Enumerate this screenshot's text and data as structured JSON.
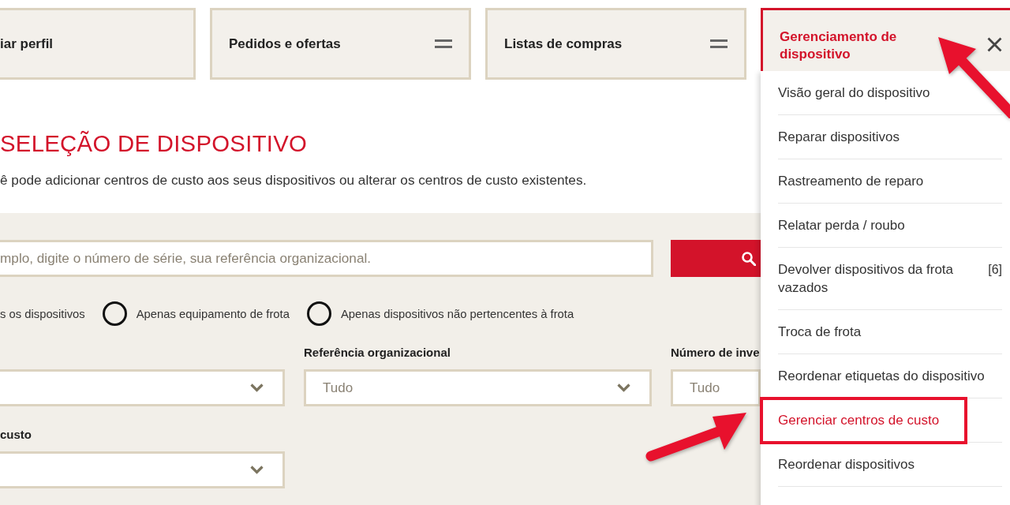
{
  "nav": {
    "tabs": [
      {
        "label": "iar perfil",
        "kind": "plain"
      },
      {
        "label": "Pedidos e ofertas",
        "kind": "menu"
      },
      {
        "label": "Listas de compras",
        "kind": "menu"
      }
    ]
  },
  "page": {
    "title": "SELEÇÃO DE DISPOSITIVO",
    "description": "ê pode adicionar centros de custo aos seus dispositivos ou alterar os centros de custo existentes."
  },
  "search": {
    "placeholder": "mplo, digite o número de série, sua referência organizacional."
  },
  "device_filter": [
    {
      "label": "s os dispositivos"
    },
    {
      "label": "Apenas equipamento de frota",
      "selected": false
    },
    {
      "label": "Apenas dispositivos não pertencentes à frota",
      "selected": false
    }
  ],
  "filters": [
    {
      "kind": "select"
    },
    {
      "kind": "select",
      "label": "Referência organizacional",
      "placeholder": "Tudo"
    },
    {
      "kind": "field",
      "label": "Número de inve",
      "placeholder": "Tudo"
    },
    {
      "kind": "select",
      "label": "custo"
    }
  ],
  "menu": {
    "title": "Gerenciamento de dispositivo",
    "expanded": true,
    "highlighted": true,
    "items": [
      {
        "label": "Visão geral do dispositivo",
        "selected": false,
        "highlighted": false
      },
      {
        "label": "Reparar dispositivos",
        "selected": false,
        "highlighted": false
      },
      {
        "label": "Rastreamento de reparo",
        "selected": false,
        "highlighted": false
      },
      {
        "label": "Relatar perda / roubo",
        "selected": false,
        "highlighted": false
      },
      {
        "label": "Devolver dispositivos da frota vazados",
        "count": "[6]",
        "selected": false,
        "highlighted": false
      },
      {
        "label": "Troca de frota",
        "selected": false,
        "highlighted": false
      },
      {
        "label": "Reordenar etiquetas do dispositivo",
        "selected": false,
        "highlighted": false
      },
      {
        "label": "Gerenciar centros de custo",
        "selected": true,
        "highlighted": true
      },
      {
        "label": "Reordenar dispositivos",
        "selected": false,
        "highlighted": false
      }
    ]
  }
}
